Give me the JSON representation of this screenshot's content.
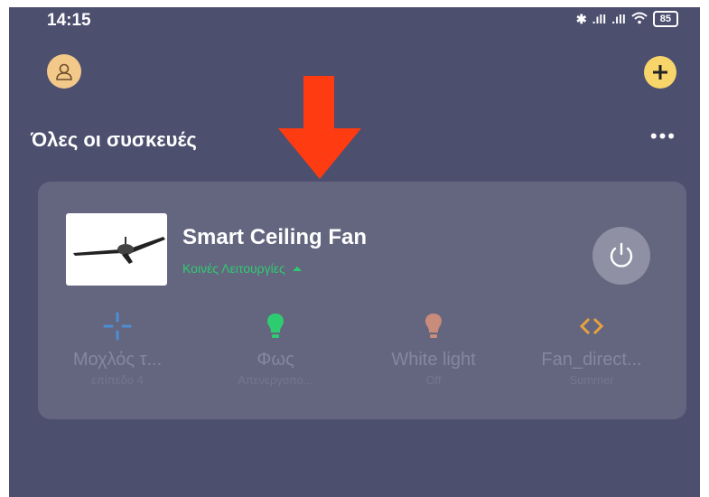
{
  "status_bar": {
    "time": "14:15",
    "battery": "85"
  },
  "page": {
    "title": "Όλες οι συσκευές",
    "more": "•••"
  },
  "device": {
    "name": "Smart Ceiling Fan",
    "subtitle": "Κοινές Λειτουργίες"
  },
  "functions": [
    {
      "icon": "fan-lever-icon",
      "label": "Μοχλός τ...",
      "value": "επίπεδο 4",
      "color": "#4a8fd6"
    },
    {
      "icon": "light-bulb-icon",
      "label": "Φως",
      "value": "Απενεργοπο...",
      "color": "#2ecc71"
    },
    {
      "icon": "white-light-icon",
      "label": "White light",
      "value": "Off",
      "color": "#c98b7a"
    },
    {
      "icon": "fan-direction-icon",
      "label": "Fan_direct...",
      "value": "Summer",
      "color": "#e8a13c"
    }
  ],
  "colors": {
    "background": "#4d4f6e",
    "card": "#64667f",
    "accent_green": "#2ecc71",
    "arrow": "#ff3b12",
    "add_button": "#f7d56b"
  }
}
